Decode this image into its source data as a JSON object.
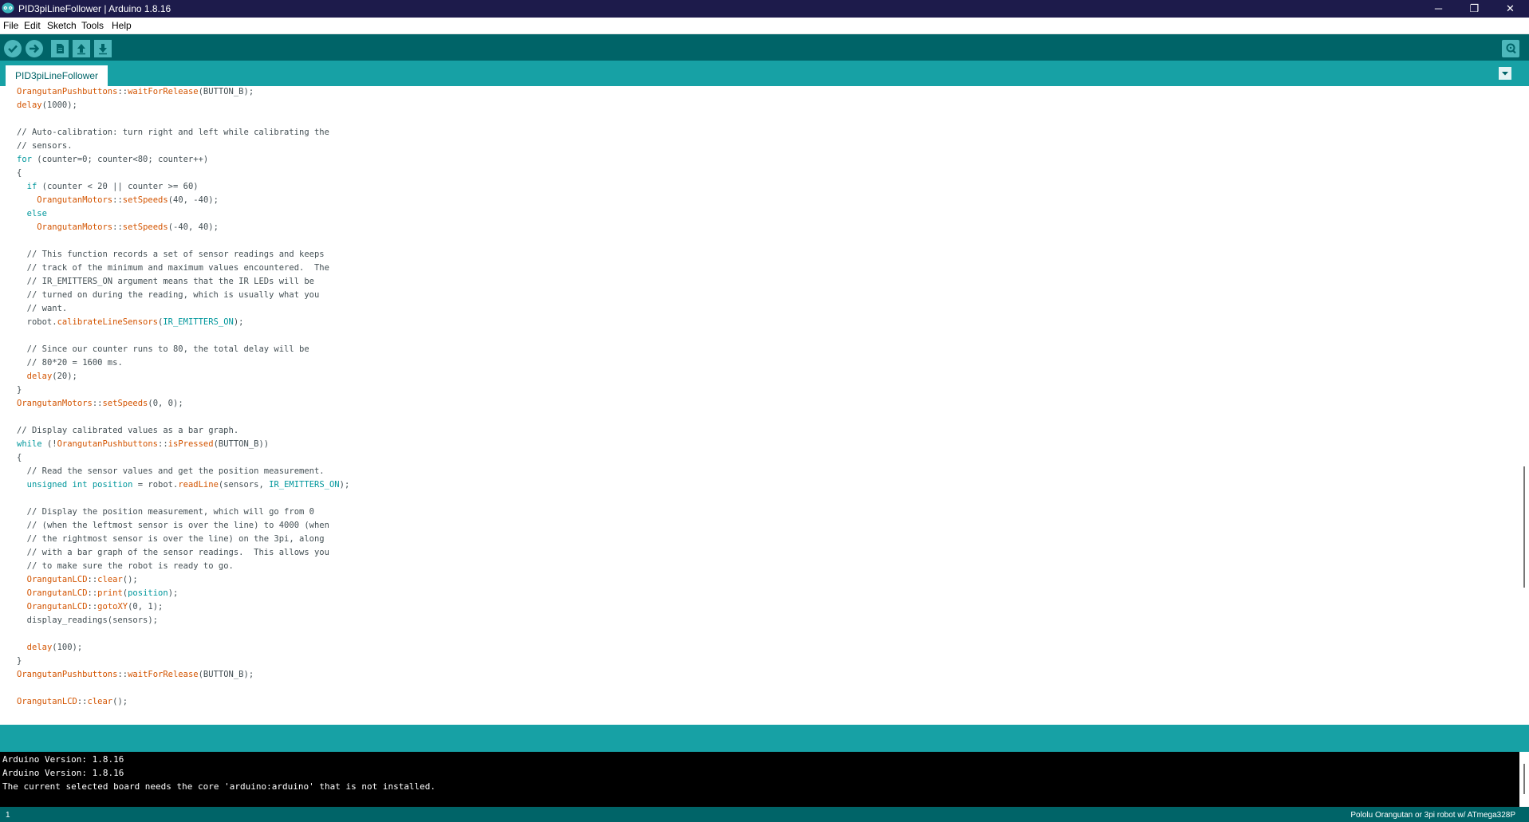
{
  "window": {
    "title": "PID3piLineFollower | Arduino 1.8.16",
    "controls": {
      "minimize": "─",
      "maximize": "❐",
      "close": "✕"
    }
  },
  "menu": {
    "items": [
      "File",
      "Edit",
      "Sketch",
      "Tools",
      "Help"
    ]
  },
  "toolbar": {
    "buttons": [
      "verify-icon",
      "upload-icon",
      "new-icon",
      "open-icon",
      "save-icon"
    ],
    "serial_monitor": "serial-monitor-icon"
  },
  "tabs": [
    {
      "label": "PID3piLineFollower",
      "active": true
    }
  ],
  "colors": {
    "teal_dark": "#006468",
    "teal": "#17a1a5",
    "keyword": "#00979c",
    "function": "#d35400",
    "class": "#d35400",
    "comment": "#434f54"
  },
  "editor": {
    "lines": [
      [
        [
          "c",
          "OrangutanPushbuttons"
        ],
        [
          "p",
          "::"
        ],
        [
          "f",
          "waitForRelease"
        ],
        [
          "p",
          "(BUTTON_B);"
        ]
      ],
      [
        [
          "f",
          "delay"
        ],
        [
          "p",
          "(1000);"
        ]
      ],
      [],
      [
        [
          "m",
          "// Auto-calibration: turn right and left while calibrating the"
        ]
      ],
      [
        [
          "m",
          "// sensors."
        ]
      ],
      [
        [
          "k",
          "for"
        ],
        [
          "p",
          " (counter=0; counter<80; counter++)"
        ]
      ],
      [
        [
          "p",
          "{"
        ]
      ],
      [
        [
          "p",
          "  "
        ],
        [
          "k",
          "if"
        ],
        [
          "p",
          " (counter < 20 || counter >= 60)"
        ]
      ],
      [
        [
          "p",
          "    "
        ],
        [
          "c",
          "OrangutanMotors"
        ],
        [
          "p",
          "::"
        ],
        [
          "f",
          "setSpeeds"
        ],
        [
          "p",
          "(40, -40);"
        ]
      ],
      [
        [
          "p",
          "  "
        ],
        [
          "k",
          "else"
        ]
      ],
      [
        [
          "p",
          "    "
        ],
        [
          "c",
          "OrangutanMotors"
        ],
        [
          "p",
          "::"
        ],
        [
          "f",
          "setSpeeds"
        ],
        [
          "p",
          "(-40, 40);"
        ]
      ],
      [],
      [
        [
          "p",
          "  "
        ],
        [
          "m",
          "// This function records a set of sensor readings and keeps"
        ]
      ],
      [
        [
          "p",
          "  "
        ],
        [
          "m",
          "// track of the minimum and maximum values encountered.  The"
        ]
      ],
      [
        [
          "p",
          "  "
        ],
        [
          "m",
          "// IR_EMITTERS_ON argument means that the IR LEDs will be"
        ]
      ],
      [
        [
          "p",
          "  "
        ],
        [
          "m",
          "// turned on during the reading, which is usually what you"
        ]
      ],
      [
        [
          "p",
          "  "
        ],
        [
          "m",
          "// want."
        ]
      ],
      [
        [
          "p",
          "  robot."
        ],
        [
          "f",
          "calibrateLineSensors"
        ],
        [
          "p",
          "("
        ],
        [
          "k",
          "IR_EMITTERS_ON"
        ],
        [
          "p",
          ");"
        ]
      ],
      [],
      [
        [
          "p",
          "  "
        ],
        [
          "m",
          "// Since our counter runs to 80, the total delay will be"
        ]
      ],
      [
        [
          "p",
          "  "
        ],
        [
          "m",
          "// 80*20 = 1600 ms."
        ]
      ],
      [
        [
          "p",
          "  "
        ],
        [
          "f",
          "delay"
        ],
        [
          "p",
          "(20);"
        ]
      ],
      [
        [
          "p",
          "}"
        ]
      ],
      [
        [
          "c",
          "OrangutanMotors"
        ],
        [
          "p",
          "::"
        ],
        [
          "f",
          "setSpeeds"
        ],
        [
          "p",
          "(0, 0);"
        ]
      ],
      [],
      [
        [
          "m",
          "// Display calibrated values as a bar graph."
        ]
      ],
      [
        [
          "k",
          "while"
        ],
        [
          "p",
          " (!"
        ],
        [
          "c",
          "OrangutanPushbuttons"
        ],
        [
          "p",
          "::"
        ],
        [
          "f",
          "isPressed"
        ],
        [
          "p",
          "(BUTTON_B))"
        ]
      ],
      [
        [
          "p",
          "{"
        ]
      ],
      [
        [
          "p",
          "  "
        ],
        [
          "m",
          "// Read the sensor values and get the position measurement."
        ]
      ],
      [
        [
          "p",
          "  "
        ],
        [
          "k",
          "unsigned int"
        ],
        [
          "p",
          " "
        ],
        [
          "k",
          "position"
        ],
        [
          "p",
          " = robot."
        ],
        [
          "f",
          "readLine"
        ],
        [
          "p",
          "(sensors, "
        ],
        [
          "k",
          "IR_EMITTERS_ON"
        ],
        [
          "p",
          ");"
        ]
      ],
      [],
      [
        [
          "p",
          "  "
        ],
        [
          "m",
          "// Display the position measurement, which will go from 0"
        ]
      ],
      [
        [
          "p",
          "  "
        ],
        [
          "m",
          "// (when the leftmost sensor is over the line) to 4000 (when"
        ]
      ],
      [
        [
          "p",
          "  "
        ],
        [
          "m",
          "// the rightmost sensor is over the line) on the 3pi, along"
        ]
      ],
      [
        [
          "p",
          "  "
        ],
        [
          "m",
          "// with a bar graph of the sensor readings.  This allows you"
        ]
      ],
      [
        [
          "p",
          "  "
        ],
        [
          "m",
          "// to make sure the robot is ready to go."
        ]
      ],
      [
        [
          "p",
          "  "
        ],
        [
          "c",
          "OrangutanLCD"
        ],
        [
          "p",
          "::"
        ],
        [
          "f",
          "clear"
        ],
        [
          "p",
          "();"
        ]
      ],
      [
        [
          "p",
          "  "
        ],
        [
          "c",
          "OrangutanLCD"
        ],
        [
          "p",
          "::"
        ],
        [
          "f",
          "print"
        ],
        [
          "p",
          "("
        ],
        [
          "k",
          "position"
        ],
        [
          "p",
          ");"
        ]
      ],
      [
        [
          "p",
          "  "
        ],
        [
          "c",
          "OrangutanLCD"
        ],
        [
          "p",
          "::"
        ],
        [
          "f",
          "gotoXY"
        ],
        [
          "p",
          "(0, 1);"
        ]
      ],
      [
        [
          "p",
          "  display_readings(sensors);"
        ]
      ],
      [],
      [
        [
          "p",
          "  "
        ],
        [
          "f",
          "delay"
        ],
        [
          "p",
          "(100);"
        ]
      ],
      [
        [
          "p",
          "}"
        ]
      ],
      [
        [
          "c",
          "OrangutanPushbuttons"
        ],
        [
          "p",
          "::"
        ],
        [
          "f",
          "waitForRelease"
        ],
        [
          "p",
          "(BUTTON_B);"
        ]
      ],
      [],
      [
        [
          "c",
          "OrangutanLCD"
        ],
        [
          "p",
          "::"
        ],
        [
          "f",
          "clear"
        ],
        [
          "p",
          "();"
        ]
      ]
    ]
  },
  "console": {
    "lines": [
      "Arduino Version: 1.8.16",
      "Arduino Version: 1.8.16",
      "The current selected board needs the core 'arduino:arduino' that is not installed."
    ]
  },
  "status": {
    "line_number": "1",
    "board": "Pololu Orangutan or 3pi robot w/ ATmega328P"
  }
}
